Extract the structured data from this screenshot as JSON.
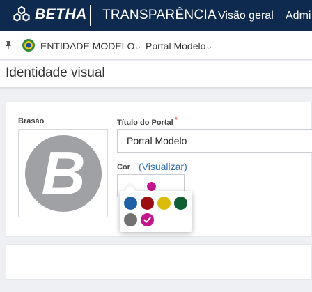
{
  "topbar": {
    "logo_text": "BETHA",
    "app_title": "TRANSPARÊNCIA",
    "nav": [
      "Visão geral",
      "Admi"
    ]
  },
  "breadcrumb": {
    "entity": "ENTIDADE MODELO",
    "portal": "Portal Modelo"
  },
  "page": {
    "title": "Identidade visual"
  },
  "form": {
    "crest_label": "Brasão",
    "crest_letter": "B",
    "portal_title_label": "Título do Portal",
    "required_mark": "*",
    "portal_title_value": "Portal Modelo",
    "color_label": "Cor",
    "color_preview_link": "(Visualizar)",
    "selected_color": "#c4148e"
  },
  "palette": {
    "colors": [
      "#1f5fa6",
      "#9b0d11",
      "#dcbc0b",
      "#0f5f33",
      "#727272",
      "#c4148e"
    ],
    "selected_index": 5
  },
  "colors": {
    "topbar_bg": "#0e2a4f",
    "link": "#2f6fb5",
    "required": "#d9333f"
  }
}
